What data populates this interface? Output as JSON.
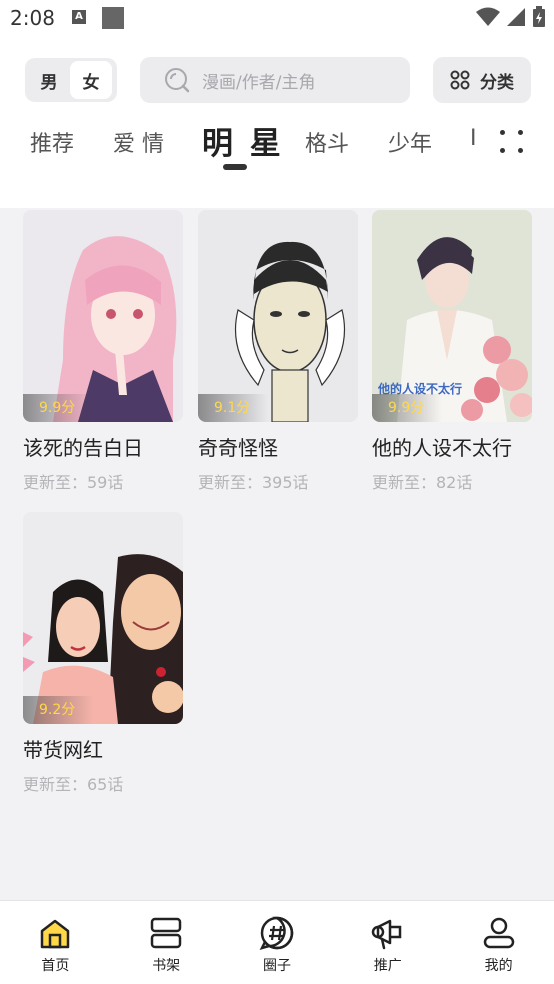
{
  "status_bar": {
    "time": "2:08",
    "notice_icon_letter": "A"
  },
  "header": {
    "gender": [
      {
        "label": "男",
        "active": false
      },
      {
        "label": "女",
        "active": true
      }
    ],
    "search": {
      "placeholder": "漫画/作者/主角"
    },
    "category_label": "分类"
  },
  "tabs": [
    {
      "label": "推荐"
    },
    {
      "label": "爱 情"
    },
    {
      "label": "明 星",
      "active": true
    },
    {
      "label": "格斗"
    },
    {
      "label": "少年"
    },
    {
      "label": "I"
    }
  ],
  "comics": [
    {
      "title": "该死的告白日",
      "score": "9.9分",
      "update": "更新至：59话"
    },
    {
      "title": "奇奇怪怪",
      "score": "9.1分",
      "update": "更新至：395话"
    },
    {
      "title": "他的人设不太行",
      "score": "9.9分",
      "update": "更新至：82话",
      "cover_text": "他的人设不太行"
    },
    {
      "title": "带货网红",
      "score": "9.2分",
      "update": "更新至：65话"
    }
  ],
  "bottom_nav": [
    {
      "label": "首页",
      "icon": "home-icon",
      "active": true
    },
    {
      "label": "书架",
      "icon": "bookshelf-icon"
    },
    {
      "label": "圈子",
      "icon": "community-icon"
    },
    {
      "label": "推广",
      "icon": "promote-icon"
    },
    {
      "label": "我的",
      "icon": "profile-icon"
    }
  ],
  "colors": {
    "accent": "#ffd84a",
    "background": "#f2f2f4"
  }
}
